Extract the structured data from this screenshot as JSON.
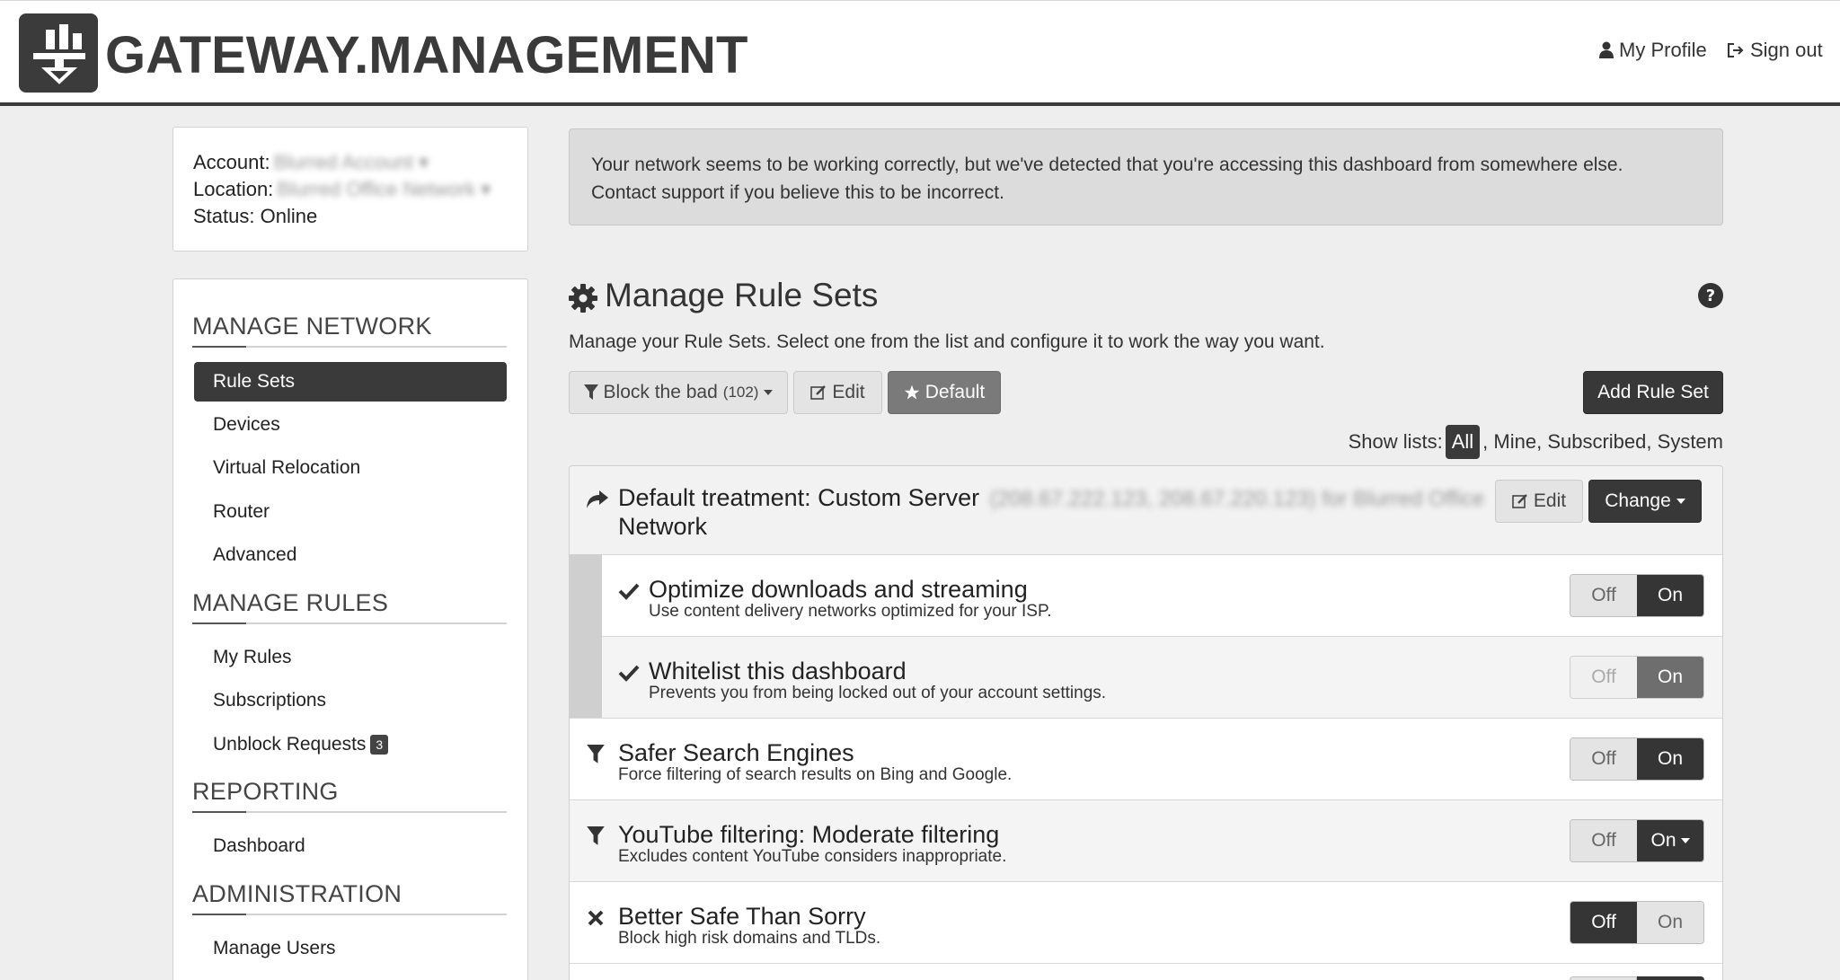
{
  "header": {
    "brand": "GATEWAY.MANAGEMENT",
    "my_profile": "My Profile",
    "sign_out": "Sign out"
  },
  "account": {
    "account_label": "Account:",
    "account_value": "Blurred Account ▾",
    "location_label": "Location:",
    "location_value": "Blurred Office Network ▾",
    "status": "Status: Online"
  },
  "sidebar": {
    "sections": [
      {
        "title": "MANAGE NETWORK"
      },
      {
        "title": "MANAGE RULES"
      },
      {
        "title": "REPORTING"
      },
      {
        "title": "ADMINISTRATION"
      }
    ],
    "items": [
      {
        "label": "Rule Sets",
        "active": true
      },
      {
        "label": "Devices"
      },
      {
        "label": "Virtual Relocation"
      },
      {
        "label": "Router"
      },
      {
        "label": "Advanced"
      },
      {
        "label": "My Rules"
      },
      {
        "label": "Subscriptions"
      },
      {
        "label": "Unblock Requests",
        "badge": "3"
      },
      {
        "label": "Dashboard"
      },
      {
        "label": "Manage Users"
      }
    ]
  },
  "alert": {
    "line1": "Your network seems to be working correctly, but we've detected that you're accessing this dashboard from somewhere else.",
    "line2": "Contact support if you believe this to be incorrect."
  },
  "main": {
    "title": "Manage Rule Sets",
    "description": "Manage your Rule Sets. Select one from the list and configure it to work the way you want.",
    "ruleset_name": "Block the bad",
    "ruleset_count": "(102)",
    "edit_label": "Edit",
    "default_label": "Default",
    "add_label": "Add Rule Set",
    "show_lists_label": "Show lists:",
    "lists": [
      "All",
      "Mine",
      "Subscribed",
      "System"
    ],
    "default_treatment": {
      "title_prefix": "Default treatment: Custom Server",
      "servers_blurred": "(208.67.222.123, 208.67.220.123) for Blurred Office",
      "title_suffix": "Network",
      "edit_label": "Edit",
      "change_label": "Change"
    },
    "rules": [
      {
        "title": "Optimize downloads and streaming",
        "sub": "Use content delivery networks optimized for your ISP.",
        "icon": "check-icon",
        "off": "Off",
        "on": "On",
        "state": "on"
      },
      {
        "title": "Whitelist this dashboard",
        "sub": "Prevents you from being locked out of your account settings.",
        "icon": "check-icon",
        "off": "Off",
        "on": "On",
        "state": "on-locked"
      },
      {
        "title": "Safer Search Engines",
        "sub": "Force filtering of search results on Bing and Google.",
        "icon": "filter-icon",
        "off": "Off",
        "on": "On",
        "state": "on"
      },
      {
        "title": "YouTube filtering: Moderate filtering",
        "sub": "Excludes content YouTube considers inappropriate.",
        "icon": "filter-icon",
        "off": "Off",
        "on": "On",
        "state": "on-dropdown"
      },
      {
        "title": "Better Safe Than Sorry",
        "sub": "Block high risk domains and TLDs.",
        "icon": "x-icon",
        "off": "Off",
        "on": "On",
        "state": "off"
      }
    ]
  }
}
